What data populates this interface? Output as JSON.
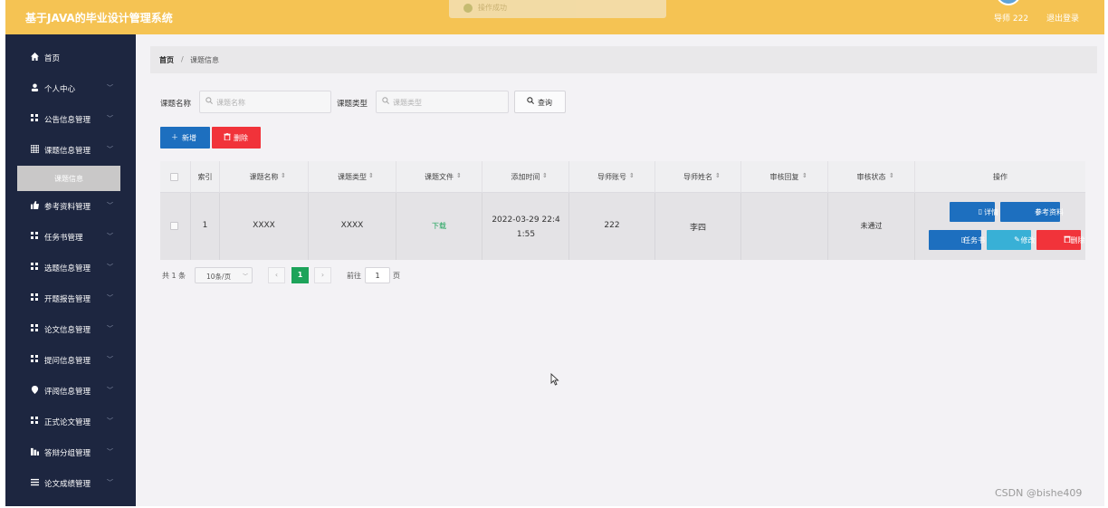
{
  "header": {
    "app_title": "基于JAVA的毕业设计管理系统",
    "user_label": "导师 222",
    "logout": "退出登录",
    "toast": "操作成功"
  },
  "sidebar": {
    "items": [
      {
        "label": "首页",
        "icon": "home-icon",
        "has_chevron": false
      },
      {
        "label": "个人中心",
        "icon": "user-icon",
        "has_chevron": true
      },
      {
        "label": "公告信息管理",
        "icon": "grid-icon",
        "has_chevron": true
      },
      {
        "label": "课题信息管理",
        "icon": "table-icon",
        "has_chevron": true
      },
      {
        "label": "参考资料管理",
        "icon": "thumb-icon",
        "has_chevron": true
      },
      {
        "label": "任务书管理",
        "icon": "grid-icon",
        "has_chevron": true
      },
      {
        "label": "选题信息管理",
        "icon": "grid-icon",
        "has_chevron": true
      },
      {
        "label": "开题报告管理",
        "icon": "grid-icon",
        "has_chevron": true
      },
      {
        "label": "论文信息管理",
        "icon": "grid-icon",
        "has_chevron": true
      },
      {
        "label": "提问信息管理",
        "icon": "grid-icon",
        "has_chevron": true
      },
      {
        "label": "评阅信息管理",
        "icon": "pin-icon",
        "has_chevron": true
      },
      {
        "label": "正式论文管理",
        "icon": "grid-icon",
        "has_chevron": true
      },
      {
        "label": "答辩分组管理",
        "icon": "bars-icon",
        "has_chevron": true
      },
      {
        "label": "论文成绩管理",
        "icon": "list-icon",
        "has_chevron": true
      }
    ],
    "active_sub": "课题信息"
  },
  "breadcrumb": {
    "home": "首页",
    "separator": "/",
    "current": "课题信息"
  },
  "filters": {
    "name_label": "课题名称",
    "name_placeholder": "课题名称",
    "type_label": "课题类型",
    "type_placeholder": "课题类型",
    "search": "查询"
  },
  "actions": {
    "add": "新增",
    "delete": "删除"
  },
  "table": {
    "headers": [
      "索引",
      "课题名称",
      "课题类型",
      "课题文件",
      "添加时间",
      "导师账号",
      "导师姓名",
      "审核回复",
      "审核状态",
      "操作"
    ],
    "rows": [
      {
        "index": "1",
        "name": "XXXX",
        "type": "XXXX",
        "file": "下载",
        "added": "2022-03-29 22:41:55",
        "teacher_account": "222",
        "teacher_name": "李四",
        "review_reply": "",
        "review_status": "未通过"
      }
    ],
    "ops": {
      "detail": "详情",
      "reference": "参考资料",
      "task": "任务书",
      "edit": "修改",
      "delete": "删除"
    }
  },
  "pagination": {
    "total": "共 1 条",
    "page_size": "10条/页",
    "current": "1",
    "goto_label": "前往",
    "goto_value": "1",
    "goto_suffix": "页"
  },
  "colors": {
    "header": "#f5c353",
    "sidebar": "#1d2640",
    "primary": "#1d6fbf",
    "danger": "#f1333a",
    "info": "#38b0d6",
    "success": "#1da35a"
  },
  "watermark": "CSDN @bishe409"
}
